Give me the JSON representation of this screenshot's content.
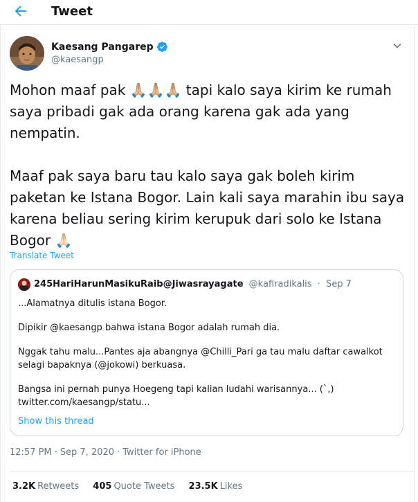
{
  "header": {
    "back_icon": "arrow-left-icon",
    "title": "Tweet",
    "accent": "#1da1f2"
  },
  "tweet": {
    "author_name": "Kaesang Pangarep",
    "author_handle": "@kaesangp",
    "verified_icon": "verified-badge-icon",
    "line1": "Mohon maaf pak ",
    "emoji1": "🙏🏼🙏🏼🙏🏼",
    "line1b": " tapi kalo saya kirim ke rumah saya pribadi gak ada orang karena gak ada yang nempatin.",
    "para2": "Maaf pak saya baru tau kalo saya gak boleh kirim paketan ke Istana Bogor. Lain kali saya marahin ibu saya karena beliau sering kirim kerupuk dari solo ke Istana Bogor ",
    "emoji2": "🙏🏻",
    "translate": "Translate Tweet"
  },
  "quote": {
    "name": "245HariHarunMasikuRaib@Jiwasrayagate",
    "handle": "@kafiradikalis",
    "date": "Sep 7",
    "p1": "...Alamatnya ditulis istana Bogor.",
    "p2": "Dipikir @kaesangp bahwa istana Bogor adalah rumah dia.",
    "p3": "Nggak tahu malu...Pantes aja abangnya @Chilli_Pari ga tau malu daftar cawalkot selagi bapaknya (@jokowi) berkuasa.",
    "p4": "Bangsa ini pernah punya Hoegeng tapi kalian ludahi warisannya... (`,)",
    "p5": "twitter.com/kaesangp/statu...",
    "show_thread": "Show this thread"
  },
  "meta": {
    "time": "12:57 PM",
    "separator": "·",
    "date": "Sep 7, 2020",
    "source": "Twitter for iPhone"
  },
  "stats": {
    "retweets_count": "3.2K",
    "retweets_label": "Retweets",
    "quotes_count": "405",
    "quotes_label": "Quote Tweets",
    "likes_count": "23.5K",
    "likes_label": "Likes"
  }
}
